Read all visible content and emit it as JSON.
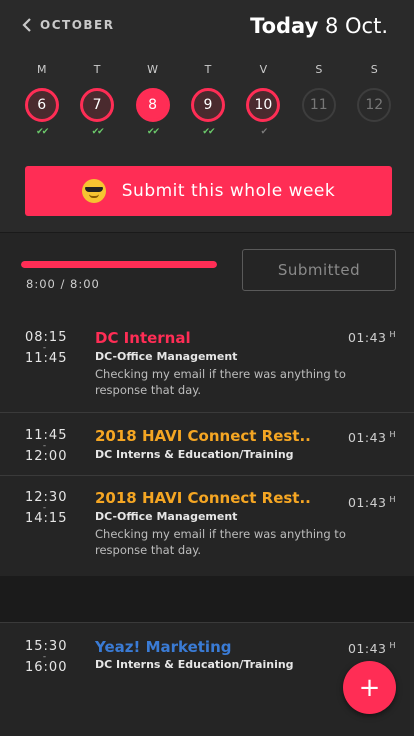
{
  "header": {
    "back_label": "OCTOBER",
    "today_word": "Today",
    "today_date": "8 Oct."
  },
  "week": [
    {
      "dow": "M",
      "num": "6",
      "state": "ring",
      "check": "✔✔",
      "check_style": "green"
    },
    {
      "dow": "T",
      "num": "7",
      "state": "ring",
      "check": "✔✔",
      "check_style": "green"
    },
    {
      "dow": "W",
      "num": "8",
      "state": "filled",
      "check": "✔✔",
      "check_style": "green"
    },
    {
      "dow": "T",
      "num": "9",
      "state": "ring",
      "check": "✔✔",
      "check_style": "green"
    },
    {
      "dow": "V",
      "num": "10",
      "state": "ring",
      "check": "✔",
      "check_style": "grey"
    },
    {
      "dow": "S",
      "num": "11",
      "state": "off",
      "check": "",
      "check_style": "grey"
    },
    {
      "dow": "S",
      "num": "12",
      "state": "off",
      "check": "",
      "check_style": "grey"
    }
  ],
  "submit_week": {
    "label": "Submit this whole week",
    "emoji_icon": "sunglasses-emoji-icon"
  },
  "progress": {
    "value": 1.0,
    "text": "8:00 / 8:00",
    "submitted_label": "Submitted"
  },
  "entries": [
    {
      "start": "08:15",
      "dash": "-",
      "end": "11:45",
      "title": "DC Internal",
      "title_color": "#ff2d55",
      "category": "DC-Office Management",
      "description": "Checking my email if there was anything to response that day.",
      "duration": "01:43",
      "unit": "H"
    },
    {
      "start": "11:45",
      "dash": "-",
      "end": "12:00",
      "title": "2018 HAVI Connect Rest..",
      "title_color": "#f5a623",
      "category": "DC Interns & Education/Training",
      "description": "",
      "duration": "01:43",
      "unit": "H"
    },
    {
      "start": "12:30",
      "dash": "-",
      "end": "14:15",
      "title": "2018 HAVI Connect Rest..",
      "title_color": "#f5a623",
      "category": "DC-Office Management",
      "description": "Checking my email if there was anything to response that day.",
      "duration": "01:43",
      "unit": "H"
    },
    {
      "start": "15:30",
      "dash": "-",
      "end": "16:00",
      "title": "Yeaz! Marketing",
      "title_color": "#3a7bd5",
      "category": "DC Interns & Education/Training",
      "description": "",
      "duration": "01:43",
      "unit": "H"
    }
  ],
  "fab": {
    "label": "+",
    "icon": "plus-icon"
  },
  "colors": {
    "accent": "#ff2d55",
    "background": "#252525",
    "check_green": "#6bc96b"
  }
}
